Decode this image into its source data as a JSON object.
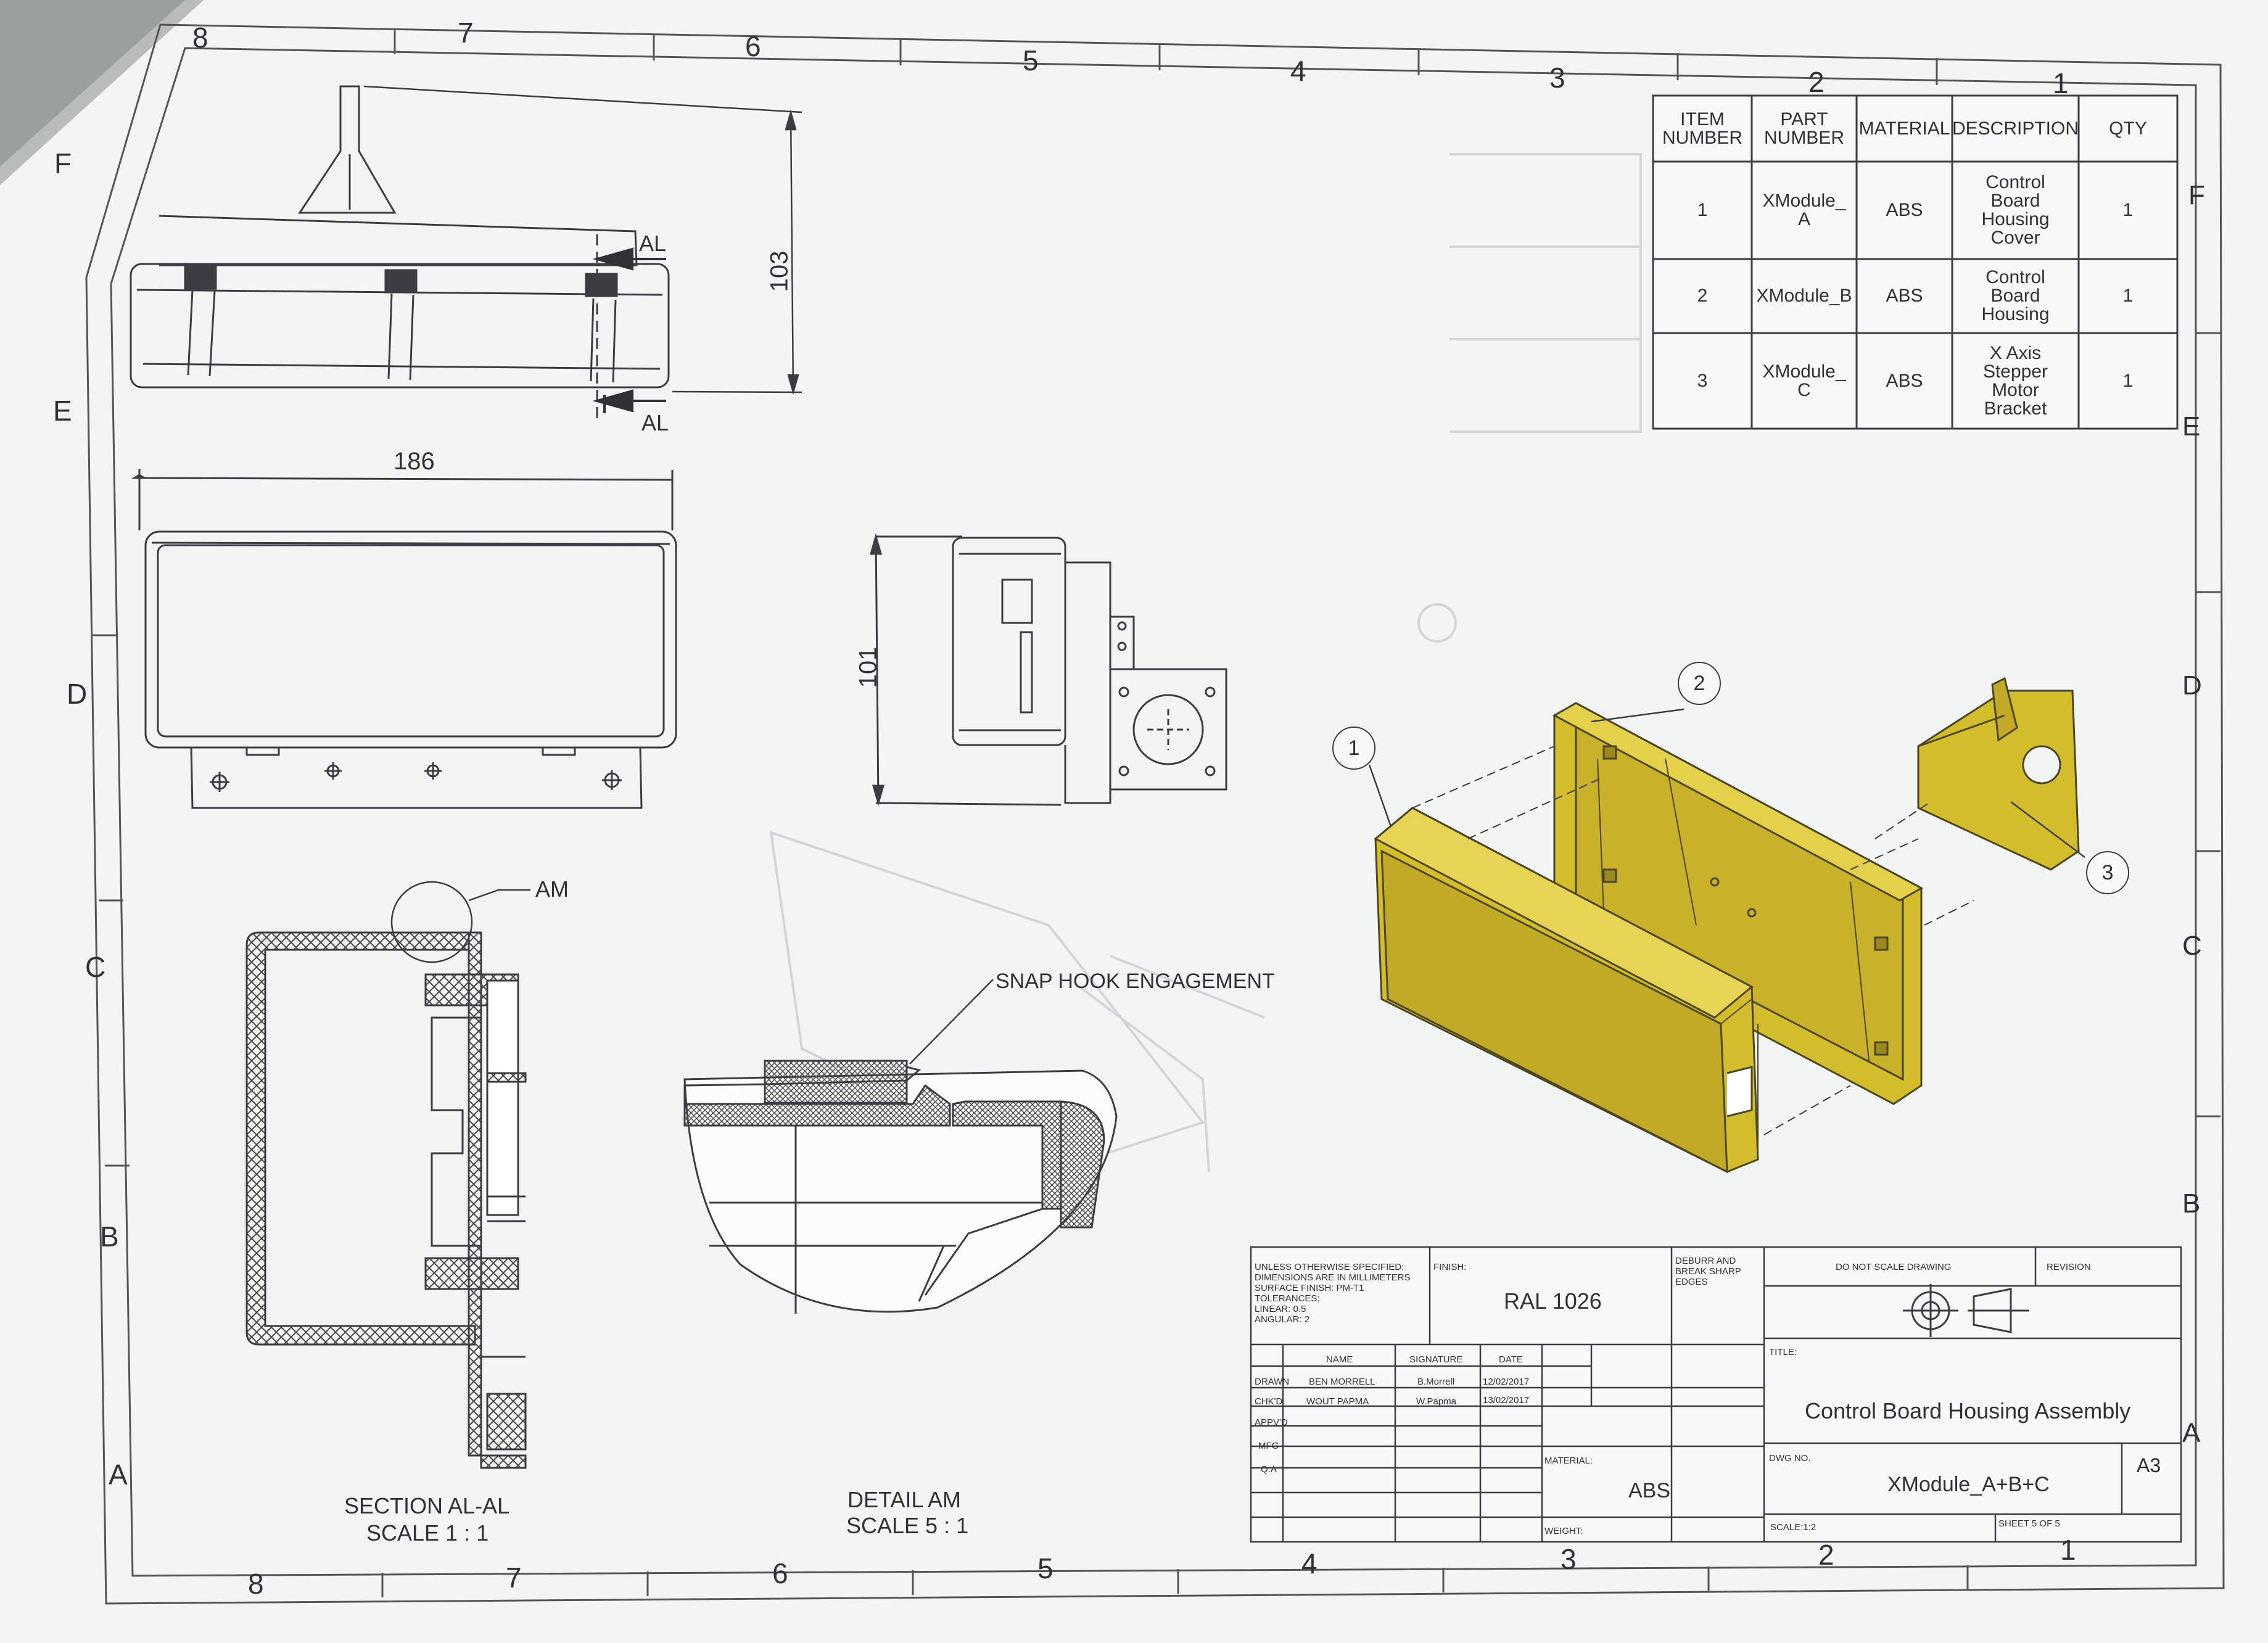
{
  "border_zones": {
    "columns_top": [
      "8",
      "7",
      "6",
      "5",
      "4",
      "3",
      "2",
      "1"
    ],
    "columns_bottom": [
      "8",
      "7",
      "6",
      "5",
      "4",
      "3",
      "2",
      "1"
    ],
    "rows_left": [
      "F",
      "E",
      "D",
      "C",
      "B",
      "A"
    ],
    "rows_right": [
      "F",
      "E",
      "D",
      "C",
      "B",
      "A"
    ]
  },
  "bom": {
    "headers": [
      "ITEM\nNUMBER",
      "PART\nNUMBER",
      "MATERIAL",
      "DESCRIPTION",
      "QTY"
    ],
    "rows": [
      {
        "item": "1",
        "part": "XModule_\nA",
        "material": "ABS",
        "description": "Control\nBoard\nHousing\nCover",
        "qty": "1"
      },
      {
        "item": "2",
        "part": "XModule_B",
        "material": "ABS",
        "description": "Control\nBoard\nHousing",
        "qty": "1"
      },
      {
        "item": "3",
        "part": "XModule_\nC",
        "material": "ABS",
        "description": "X Axis\nStepper\nMotor\nBracket",
        "qty": "1"
      }
    ]
  },
  "dimensions": {
    "height": "103",
    "width": "186",
    "side_height": "101"
  },
  "section_markers": {
    "al": "AL",
    "am": "AM"
  },
  "callouts": {
    "snap": "SNAP HOOK ENGAGEMENT"
  },
  "balloons": [
    "1",
    "2",
    "3"
  ],
  "view_labels": {
    "section_title": "SECTION AL-AL",
    "section_scale": "SCALE 1 : 1",
    "detail_title": "DETAIL AM",
    "detail_scale": "SCALE 5 : 1"
  },
  "title_block": {
    "notes": "UNLESS OTHERWISE SPECIFIED:\nDIMENSIONS ARE IN MILLIMETERS\nSURFACE FINISH: PM-T1\nTOLERANCES:\n   LINEAR: 0.5\n   ANGULAR: 2",
    "finish_label": "FINISH:",
    "finish": "RAL 1026",
    "deburr": "DEBURR AND\nBREAK SHARP\nEDGES",
    "do_not_scale": "DO NOT SCALE DRAWING",
    "revision_label": "REVISION",
    "col_name": "NAME",
    "col_signature": "SIGNATURE",
    "col_date": "DATE",
    "drawn_label": "DRAWN",
    "drawn_name": "BEN MORRELL",
    "drawn_sig": "B.Morrell",
    "drawn_date": "12/02/2017",
    "chkd_label": "CHK'D",
    "chkd_name": "WOUT PAPMA",
    "chkd_sig": "W.Papma",
    "chkd_date": "13/02/2017",
    "appvd_label": "APPV'D",
    "mfg_label": "MFG",
    "qa_label": "Q.A",
    "material_label": "MATERIAL:",
    "material": "ABS",
    "weight_label": "WEIGHT:",
    "title_label": "TITLE:",
    "title": "Control Board Housing Assembly",
    "dwg_label": "DWG NO.",
    "dwg_no": "XModule_A+B+C",
    "size": "A3",
    "scale": "SCALE:1:2",
    "sheet": "SHEET 5 OF 5"
  },
  "colors": {
    "part": "#d4bd2a",
    "line": "#3a3d42",
    "paper": "#f3f5f4",
    "background": "#9aa09c"
  }
}
